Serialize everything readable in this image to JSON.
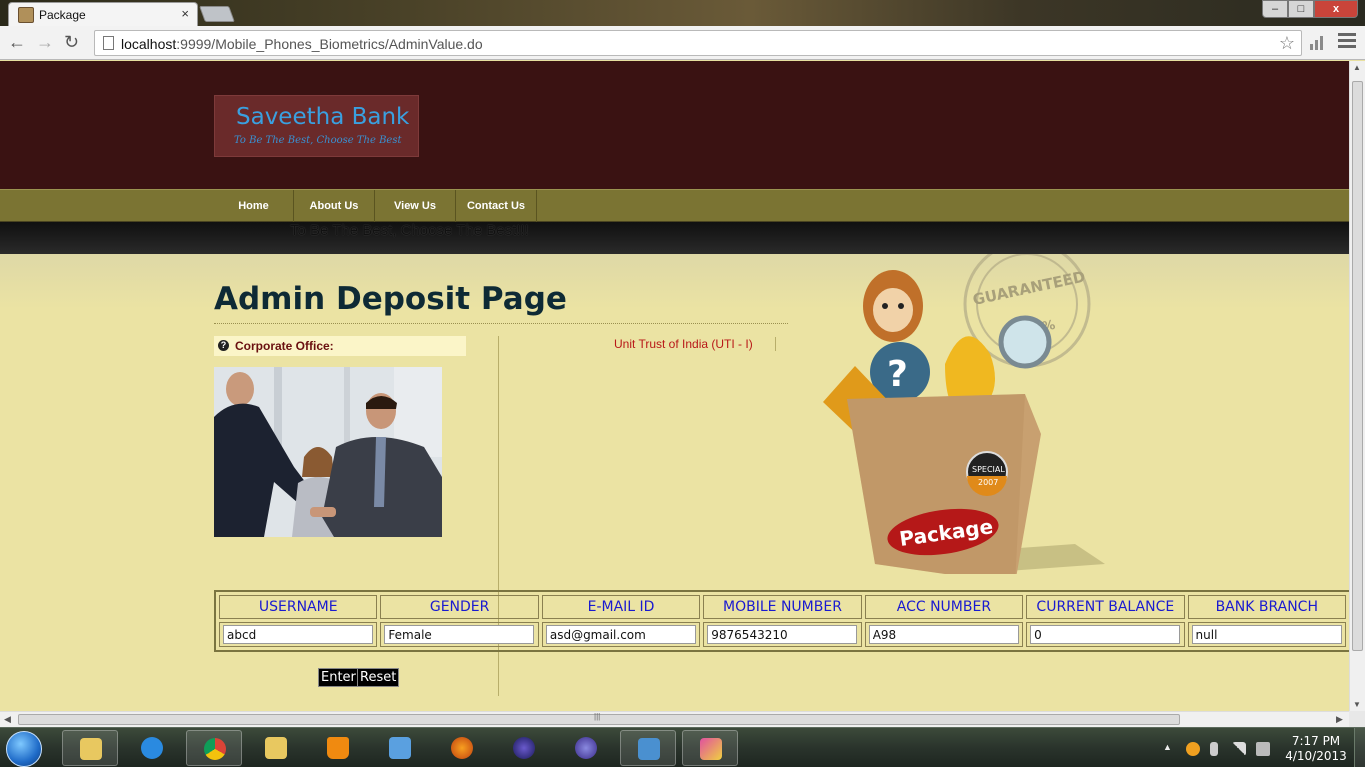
{
  "browser": {
    "tab_title": "Package",
    "tab_close": "×",
    "url_host": "localhost",
    "url_rest": ":9999/Mobile_Phones_Biometrics/AdminValue.do",
    "back_icon": "arrow-left",
    "forward_icon": "arrow-right",
    "reload_icon": "reload",
    "star_icon": "star"
  },
  "window_controls": {
    "minimize": "–",
    "maximize": "□",
    "close": "x"
  },
  "site": {
    "logo_name": "Saveetha Bank",
    "logo_tagline": "To Be The Best, Choose The Best",
    "nav": [
      "Home",
      "About Us",
      "View Us",
      "Contact Us"
    ],
    "marquee": "To Be The Best, Choose The Best!!!",
    "page_title": "Admin Deposit Page",
    "side_heading": "Corporate Office:",
    "link_uti": "Unit Trust of India (UTI - I)",
    "package_label": "Package",
    "stamp_text": "GUARANTEED",
    "stamp_number": "100%",
    "special_label": "SPECIAL",
    "special_year": "2007"
  },
  "table": {
    "headers": [
      "USERNAME",
      "GENDER",
      "E-MAIL ID",
      "MOBILE NUMBER",
      "ACC NUMBER",
      "CURRENT BALANCE",
      "BANK BRANCH"
    ],
    "values": [
      "abcd",
      "Female",
      "asd@gmail.com",
      "9876543210",
      "A98",
      "0",
      "null"
    ]
  },
  "buttons": {
    "enter": "Enter",
    "reset": "Reset"
  },
  "taskbar": {
    "apps": [
      "explorer",
      "internet-explorer",
      "chrome",
      "word",
      "vlc",
      "media-player",
      "firefox",
      "eclipse",
      "browser-app",
      "remote-desktop",
      "tool"
    ],
    "time": "7:17 PM",
    "date": "4/10/2013"
  },
  "colors": {
    "header_bg": "#3a1212",
    "nav_bg": "#7b7433",
    "content_bg": "#ebe3a3",
    "table_header_text": "#1a1ad0",
    "link_red": "#b81818"
  }
}
